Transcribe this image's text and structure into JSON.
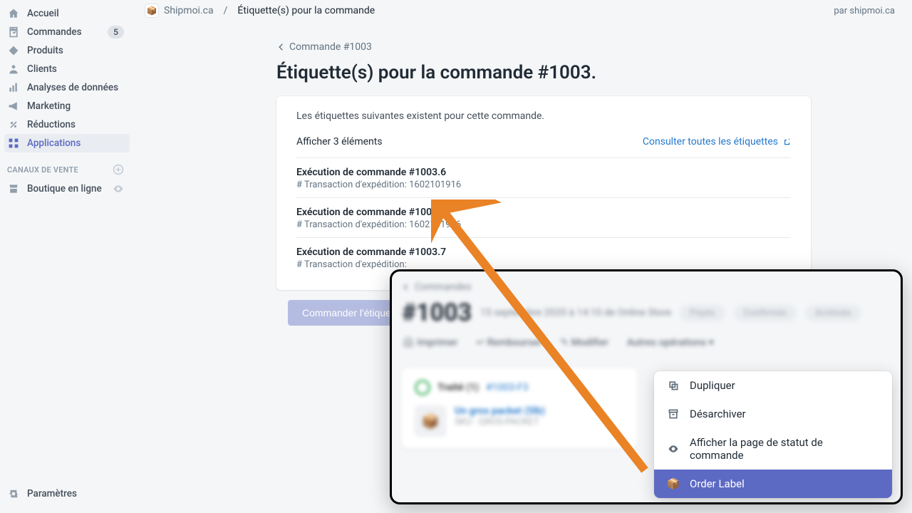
{
  "sidebar": {
    "items": [
      {
        "label": "Accueil",
        "icon": "home-icon"
      },
      {
        "label": "Commandes",
        "icon": "orders-icon",
        "badge": "5"
      },
      {
        "label": "Produits",
        "icon": "products-icon"
      },
      {
        "label": "Clients",
        "icon": "customers-icon"
      },
      {
        "label": "Analyses de données",
        "icon": "analytics-icon"
      },
      {
        "label": "Marketing",
        "icon": "marketing-icon"
      },
      {
        "label": "Réductions",
        "icon": "discounts-icon"
      },
      {
        "label": "Applications",
        "icon": "apps-icon",
        "active": true
      }
    ],
    "channels_header": "CANAUX DE VENTE",
    "channels": [
      {
        "label": "Boutique en ligne",
        "icon": "store-icon"
      }
    ],
    "settings_label": "Paramètres"
  },
  "topbar": {
    "app_name": "Shipmoi.ca",
    "breadcrumb": "Étiquette(s) pour la commande",
    "attribution": "par shipmoi.ca"
  },
  "page": {
    "back_label": "Commande #1003",
    "title": "Étiquette(s) pour la commande #1003.",
    "card": {
      "intro": "Les étiquettes suivantes existent pour cette commande.",
      "count_text": "Afficher 3 éléments",
      "view_all_link": "Consulter toutes les étiquettes",
      "items": [
        {
          "title": "Exécution de commande #1003.6",
          "sub": "# Transaction d'expédition: 1602101916"
        },
        {
          "title": "Exécution de commande #1003.5",
          "sub": "# Transaction d'expédition: 1602101916"
        },
        {
          "title": "Exécution de commande #1003.7",
          "sub": "# Transaction d'expédition:"
        }
      ],
      "action_button": "Commander l'étiquette"
    }
  },
  "overlay": {
    "back": "Commandes",
    "order_number": "#1003",
    "meta_line": "15 septembre 2020 à 14:10 de Online Store",
    "badges": [
      "Payés",
      "Confirmés",
      "Archivés"
    ],
    "ops": [
      "Imprimer",
      "Rembourser",
      "Modifier",
      "Autres opérations"
    ],
    "status": "Traité (1)",
    "fulfillment": "#1003-F3",
    "product": "Un gros packet (5lb)",
    "sku": "SKU : GROS-PACKET",
    "dropdown": [
      {
        "label": "Dupliquer",
        "icon": "duplicate-icon"
      },
      {
        "label": "Désarchiver",
        "icon": "unarchive-icon"
      },
      {
        "label": "Afficher la page de statut de commande",
        "icon": "eye-icon"
      },
      {
        "label": "Order Label",
        "icon": "app-icon",
        "highlight": true
      }
    ]
  }
}
